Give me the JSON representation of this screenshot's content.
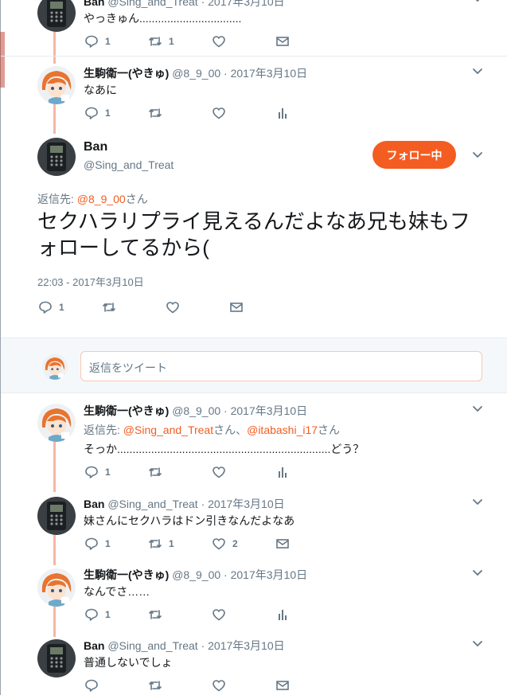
{
  "colors": {
    "accent": "#f45d22",
    "muted": "#657786",
    "thread": "#f7b7a3"
  },
  "tweets": [
    {
      "name": "Ban",
      "handle": "@Sing_and_Treat",
      "date": "2017年3月10日",
      "text": "やっきゅん.................................",
      "reply": "1",
      "retweet": "1",
      "like": "",
      "last_icon": "mail-icon"
    },
    {
      "name": "生駒衛一(やきゅ)",
      "handle": "@8_9_00",
      "date": "2017年3月10日",
      "text": "なあに",
      "reply": "1",
      "retweet": "",
      "like": "",
      "last_icon": "analytics-icon"
    },
    {
      "name": "生駒衛一(やきゅ)",
      "handle": "@8_9_00",
      "date": "2017年3月10日",
      "replyto_prefix": "返信先: ",
      "replyto_user1": "@Sing_and_Treat",
      "replyto_sep": "さん、",
      "replyto_user2": "@itabashi_i17",
      "replyto_suffix": "さん",
      "text": "そっか.....................................................................どう？",
      "reply": "1",
      "retweet": "",
      "like": "",
      "last_icon": "analytics-icon"
    },
    {
      "name": "Ban",
      "handle": "@Sing_and_Treat",
      "date": "2017年3月10日",
      "text": "妹さんにセクハラはドン引きなんだよなあ",
      "reply": "1",
      "retweet": "1",
      "like": "2",
      "last_icon": "mail-icon"
    },
    {
      "name": "生駒衛一(やきゅ)",
      "handle": "@8_9_00",
      "date": "2017年3月10日",
      "text": "なんでさ……",
      "reply": "1",
      "retweet": "",
      "like": "",
      "last_icon": "analytics-icon"
    },
    {
      "name": "Ban",
      "handle": "@Sing_and_Treat",
      "date": "2017年3月10日",
      "text": "普通しないでしょ",
      "reply": "",
      "retweet": "",
      "like": "",
      "last_icon": "mail-icon"
    }
  ],
  "main": {
    "name": "Ban",
    "handle": "@Sing_and_Treat",
    "follow_label": "フォロー中",
    "replyto_prefix": "返信先: ",
    "replyto_user": "@8_9_00",
    "replyto_suffix": "さん",
    "text": "セクハラリプライ見えるんだよなあ兄も妹もフォローしてるから(",
    "time": "22:03 - 2017年3月10日",
    "reply": "1"
  },
  "reply_box": {
    "placeholder": "返信をツイート"
  }
}
